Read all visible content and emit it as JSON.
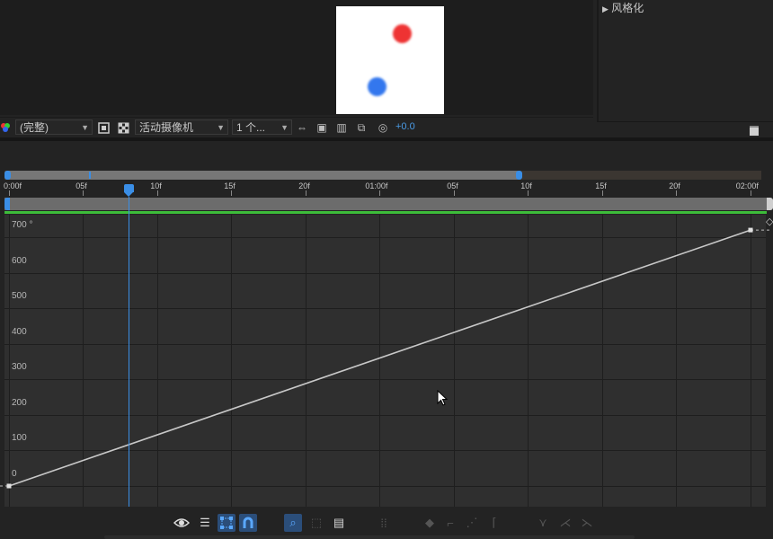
{
  "right_panel": {
    "stylize_label": "风格化"
  },
  "viewer_toolbar": {
    "resolution": "(完整)",
    "camera": "活动摄像机",
    "views": "1 个...",
    "exposure": "+0.0"
  },
  "ruler": {
    "ticks": [
      "0:00f",
      "05f",
      "10f",
      "15f",
      "20f",
      "01:00f",
      "05f",
      "10f",
      "15f",
      "20f",
      "02:00f"
    ]
  },
  "graph": {
    "y_labels": [
      "700 °",
      "600",
      "500",
      "400",
      "300",
      "200",
      "100",
      "0"
    ],
    "keyframes": [
      {
        "time_frames": 0,
        "value_deg": 0
      },
      {
        "time_frames": 50,
        "value_deg": 720
      }
    ],
    "current_time_frames": 8
  },
  "colors": {
    "accent": "#3a8ee6",
    "curve": "#c8c8c8",
    "green_bar": "#3dbd3a",
    "red_ball": "#ee3333",
    "blue_ball": "#3377ee"
  },
  "icons": {
    "bottom_toolbar": [
      "eye-icon",
      "graph-type-icon",
      "transform-box-icon",
      "snap-icon",
      "fit-selection-icon",
      "fit-all-icon",
      "fit-all-graphs-icon",
      "separate-dimensions-icon",
      "edit-keyframe-icon",
      "convert-hold-icon",
      "convert-linear-icon",
      "convert-auto-bezier-icon",
      "easy-ease-icon",
      "easy-ease-in-icon",
      "easy-ease-out-icon"
    ]
  }
}
